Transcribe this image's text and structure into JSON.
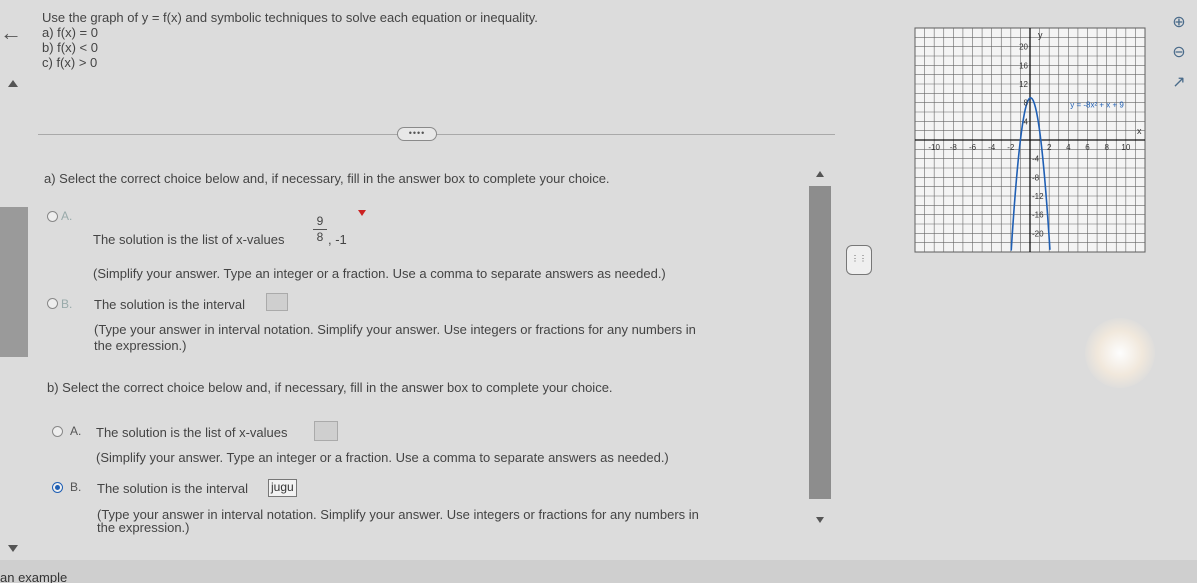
{
  "question": {
    "prompt": "Use the graph of y = f(x) and symbolic techniques to solve each equation or inequality.",
    "items": [
      "a) f(x) = 0",
      "b) f(x) < 0",
      "c) f(x) > 0"
    ]
  },
  "more_button": "••••",
  "part_a": {
    "instruction": "a) Select the correct choice below and, if necessary, fill in the answer box to complete your choice.",
    "option_a": {
      "letter": "A.",
      "text": "The solution is the list of x-values",
      "answer_num": "9",
      "answer_den": "8",
      "answer_rest": ", -1",
      "hint": "(Simplify your answer. Type an integer or a fraction. Use a comma to separate answers as needed.)"
    },
    "option_b": {
      "letter": "B.",
      "text": "The solution is the interval",
      "hint_line1": "(Type your answer in interval notation. Simplify your answer. Use integers or fractions for any numbers in",
      "hint_line2": "the expression.)"
    }
  },
  "part_b": {
    "instruction": "b) Select the correct choice below and, if necessary, fill in the answer box to complete your choice.",
    "option_a": {
      "letter": "A.",
      "text": "The solution is the list of x-values",
      "hint": "(Simplify your answer. Type an integer or a fraction. Use a comma to separate answers as needed.)"
    },
    "option_b": {
      "letter": "B.",
      "text": "The solution is the interval",
      "answer": "jugu",
      "hint_line1": "(Type your answer in interval notation. Simplify your answer. Use integers or fractions for any numbers in",
      "hint_line2": "the expression.)"
    }
  },
  "graph": {
    "y_axis_label": "y",
    "x_axis_label": "x",
    "equation": "y = -8x² + x + 9",
    "x_ticks": [
      "-10",
      "-8",
      "-6",
      "-4",
      "-2",
      "2",
      "4",
      "6",
      "8",
      "10"
    ],
    "y_ticks_pos": [
      "20",
      "16",
      "12",
      "8",
      "4"
    ],
    "y_ticks_neg": [
      "-4",
      "-8",
      "-12",
      "-16",
      "-20"
    ]
  },
  "side_icons": [
    "zoom-in-icon",
    "zoom-out-icon",
    "external-link-icon"
  ],
  "bottom_text": "an example"
}
